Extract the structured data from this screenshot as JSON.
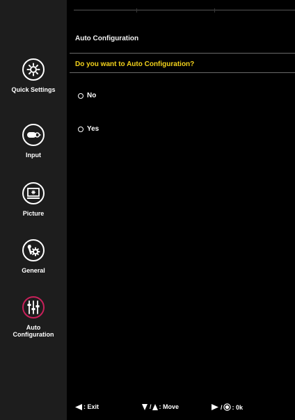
{
  "sidebar": {
    "items": [
      {
        "label": "Quick Settings",
        "icon": "sun-gear-icon"
      },
      {
        "label": "Input",
        "icon": "input-plug-icon"
      },
      {
        "label": "Picture",
        "icon": "picture-monitor-icon"
      },
      {
        "label": "General",
        "icon": "wrench-gear-icon"
      },
      {
        "label": "Auto Configuration",
        "icon": "equalizer-sliders-icon",
        "active": true
      }
    ],
    "active_color": "#c8205a"
  },
  "main": {
    "section_title": "Auto Configuration",
    "question": "Do you want to Auto Configuration?",
    "options": [
      {
        "label": "No"
      },
      {
        "label": "Yes"
      }
    ],
    "question_color": "#f3d21b"
  },
  "footer": {
    "exit_label": ": Exit",
    "move_label": ": Move",
    "ok_label": ": 0k"
  }
}
